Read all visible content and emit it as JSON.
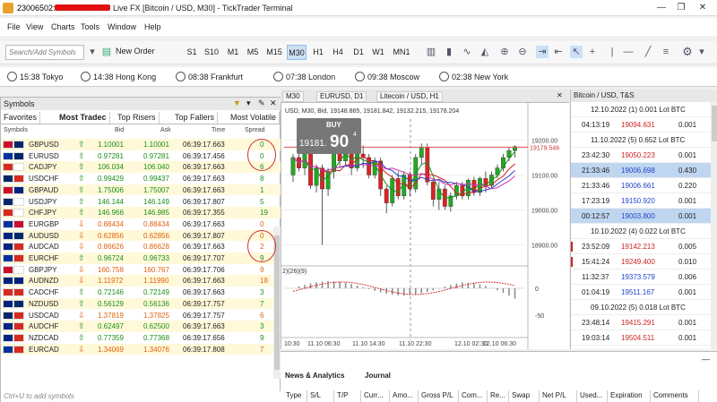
{
  "window": {
    "title_prefix": "23006502:",
    "title_suffix": "Live FX [Bitcoin / USD, M30] - TickTrader Terminal",
    "controls": [
      "—",
      "❐",
      "✕"
    ]
  },
  "menu": [
    "File",
    "View",
    "Charts",
    "Tools",
    "Window",
    "Help"
  ],
  "toolbar": {
    "search_placeholder": "Search/Add Symbols",
    "new_order": "New Order",
    "timeframes": [
      "S1",
      "S10",
      "M1",
      "M5",
      "M15",
      "M30",
      "H1",
      "H4",
      "D1",
      "W1",
      "MN1"
    ],
    "active_timeframe": "M30"
  },
  "clocks": [
    {
      "time": "15:38",
      "city": "Tokyo"
    },
    {
      "time": "14:38",
      "city": "Hong Kong"
    },
    {
      "time": "08:38",
      "city": "Frankfurt"
    },
    {
      "time": "07:38",
      "city": "London"
    },
    {
      "time": "09:38",
      "city": "Moscow"
    },
    {
      "time": "02:38",
      "city": "New York"
    }
  ],
  "symbols_panel": {
    "title": "Symbols",
    "tabs": [
      "Favorites",
      "Most Tradec",
      "Top Risers",
      "Top Fallers",
      "Most Volatile"
    ],
    "selected_tab": "Most Tradec",
    "columns": {
      "symbol": "Symbols",
      "bid": "Bid",
      "ask": "Ask",
      "time": "Time",
      "spread": "Spread"
    },
    "rows": [
      {
        "symbol": "GBPUSD",
        "dir": "up",
        "bid": "1.10001",
        "ask": "1.10001",
        "time": "06:39:17.663",
        "spread": "0",
        "flags": [
          "#c8102e",
          "#002868"
        ]
      },
      {
        "symbol": "EURUSD",
        "dir": "up",
        "bid": "0.97281",
        "ask": "0.97281",
        "time": "06:39:17.456",
        "spread": "0",
        "flags": [
          "#003399",
          "#002868"
        ]
      },
      {
        "symbol": "CADJPY",
        "dir": "up",
        "bid": "106.034",
        "ask": "106.040",
        "time": "06:39:17.663",
        "spread": "6",
        "flags": [
          "#d52b1e",
          "#ffffff"
        ]
      },
      {
        "symbol": "USDCHF",
        "dir": "up",
        "bid": "0.99429",
        "ask": "0.99437",
        "time": "06:39:17.663",
        "spread": "8",
        "flags": [
          "#002868",
          "#d52b1e"
        ]
      },
      {
        "symbol": "GBPAUD",
        "dir": "up",
        "bid": "1.75006",
        "ask": "1.75007",
        "time": "06:39:17.663",
        "spread": "1",
        "flags": [
          "#c8102e",
          "#00247d"
        ]
      },
      {
        "symbol": "USDJPY",
        "dir": "up",
        "bid": "146.144",
        "ask": "146.149",
        "time": "06:39:17.807",
        "spread": "5",
        "flags": [
          "#002868",
          "#ffffff"
        ]
      },
      {
        "symbol": "CHFJPY",
        "dir": "up",
        "bid": "146.966",
        "ask": "146.985",
        "time": "06:39:17.355",
        "spread": "19",
        "flags": [
          "#d52b1e",
          "#ffffff"
        ]
      },
      {
        "symbol": "EURGBP",
        "dir": "down",
        "bid": "0.88434",
        "ask": "0.88434",
        "time": "06:39:17.663",
        "spread": "0",
        "flags": [
          "#003399",
          "#c8102e"
        ]
      },
      {
        "symbol": "AUDUSD",
        "dir": "down",
        "bid": "0.62856",
        "ask": "0.62856",
        "time": "06:39:17.807",
        "spread": "0",
        "flags": [
          "#00247d",
          "#002868"
        ]
      },
      {
        "symbol": "AUDCAD",
        "dir": "down",
        "bid": "0.86626",
        "ask": "0.86628",
        "time": "06:39:17.663",
        "spread": "2",
        "flags": [
          "#00247d",
          "#d52b1e"
        ]
      },
      {
        "symbol": "EURCHF",
        "dir": "up",
        "bid": "0.96724",
        "ask": "0.96733",
        "time": "06:39:17.707",
        "spread": "9",
        "flags": [
          "#003399",
          "#d52b1e"
        ]
      },
      {
        "symbol": "GBPJPY",
        "dir": "down",
        "bid": "160.758",
        "ask": "160.767",
        "time": "06:39:17.706",
        "spread": "9",
        "flags": [
          "#c8102e",
          "#ffffff"
        ]
      },
      {
        "symbol": "AUDNZD",
        "dir": "down",
        "bid": "1.11972",
        "ask": "1.11990",
        "time": "06:39:17.663",
        "spread": "18",
        "flags": [
          "#00247d",
          "#00247d"
        ]
      },
      {
        "symbol": "CADCHF",
        "dir": "up",
        "bid": "0.72146",
        "ask": "0.72149",
        "time": "06:39:17.663",
        "spread": "3",
        "flags": [
          "#d52b1e",
          "#d52b1e"
        ]
      },
      {
        "symbol": "NZDUSD",
        "dir": "up",
        "bid": "0.56129",
        "ask": "0.56136",
        "time": "06:39:17.757",
        "spread": "7",
        "flags": [
          "#00247d",
          "#002868"
        ]
      },
      {
        "symbol": "USDCAD",
        "dir": "down",
        "bid": "1.37819",
        "ask": "1.37825",
        "time": "06:39:17.757",
        "spread": "6",
        "flags": [
          "#002868",
          "#d52b1e"
        ]
      },
      {
        "symbol": "AUDCHF",
        "dir": "up",
        "bid": "0.62497",
        "ask": "0.62500",
        "time": "06:39:17.663",
        "spread": "3",
        "flags": [
          "#00247d",
          "#d52b1e"
        ]
      },
      {
        "symbol": "NZDCAD",
        "dir": "up",
        "bid": "0.77359",
        "ask": "0.77368",
        "time": "06:39:17.656",
        "spread": "9",
        "flags": [
          "#00247d",
          "#d52b1e"
        ]
      },
      {
        "symbol": "EURCAD",
        "dir": "down",
        "bid": "1.34069",
        "ask": "1.34076",
        "time": "06:39:17.808",
        "spread": "7",
        "flags": [
          "#003399",
          "#d52b1e"
        ]
      }
    ],
    "footer_hint": "Ctrl+U to add symbols"
  },
  "chart": {
    "tabs": [
      "M30",
      "EURUSD, D1",
      "Litecoin / USD, H1"
    ],
    "info_line": "USD, M30, Bid, 19148.865, 19181.842, 19132.215, 19178.204",
    "buy_label": "BUY",
    "price_main": "19181.",
    "price_big": "90",
    "price_small": "4",
    "price_axis": [
      "19200.00",
      "19100.00",
      "19000.00",
      "18900.00"
    ],
    "current_price_label": "19179.546",
    "indicator_label": "2)(26)(9)",
    "indicator_axis": [
      "0",
      "-50"
    ],
    "time_axis": [
      "10:30",
      "11.10 06:30",
      "11.10 14:30",
      "11.10 22:30",
      "12.10 02:30",
      "12.10 06:30"
    ],
    "up_color": "#22aa22",
    "down_color": "#dd2222"
  },
  "time_sales": {
    "title": "Bitcoin / USD, T&S",
    "rows": [
      {
        "kind": "header",
        "text": "12.10.2022 (1) 0.001 Lot BTC"
      },
      {
        "kind": "trade",
        "time": "04:13:19",
        "price": "19094.631",
        "vol": "0.001",
        "color": "#cc2222",
        "mark": ""
      },
      {
        "kind": "header",
        "text": "11.10.2022 (5) 0.652 Lot BTC"
      },
      {
        "kind": "trade",
        "time": "23:42:30",
        "price": "19050.223",
        "vol": "0.001",
        "color": "#cc2222",
        "mark": ""
      },
      {
        "kind": "trade",
        "time": "21:33:46",
        "price": "19006.698",
        "vol": "0.430",
        "color": "#2244cc",
        "mark": "sel"
      },
      {
        "kind": "trade",
        "time": "21:33:46",
        "price": "19006.661",
        "vol": "0.220",
        "color": "#2244cc",
        "mark": ""
      },
      {
        "kind": "trade",
        "time": "17:23:19",
        "price": "19150.920",
        "vol": "0.001",
        "color": "#2244cc",
        "mark": ""
      },
      {
        "kind": "trade",
        "time": "00:12:57",
        "price": "19003.800",
        "vol": "0.001",
        "color": "#2244cc",
        "mark": "sel"
      },
      {
        "kind": "header",
        "text": "10.10.2022 (4) 0.022 Lot BTC"
      },
      {
        "kind": "trade",
        "time": "23:52:09",
        "price": "19142.213",
        "vol": "0.005",
        "color": "#cc2222",
        "mark": "red"
      },
      {
        "kind": "trade",
        "time": "15:41:24",
        "price": "19249.400",
        "vol": "0.010",
        "color": "#cc2222",
        "mark": "red"
      },
      {
        "kind": "trade",
        "time": "11:32:37",
        "price": "19373.579",
        "vol": "0.006",
        "color": "#2244cc",
        "mark": ""
      },
      {
        "kind": "trade",
        "time": "01:04:19",
        "price": "19511.167",
        "vol": "0.001",
        "color": "#2244cc",
        "mark": ""
      },
      {
        "kind": "header",
        "text": "09.10.2022 (5) 0.018 Lot BTC"
      },
      {
        "kind": "trade",
        "time": "23:48:14",
        "price": "19415.291",
        "vol": "0.001",
        "color": "#cc2222",
        "mark": ""
      },
      {
        "kind": "trade",
        "time": "19:03:14",
        "price": "19504.511",
        "vol": "0.001",
        "color": "#cc2222",
        "mark": ""
      }
    ]
  },
  "bottom_panel": {
    "tabs": [
      "News & Analytics",
      "Journal"
    ],
    "columns": [
      "Type",
      "S/L",
      "T/P",
      "Curr...",
      "Amo...",
      "Gross P/L",
      "Com...",
      "Re...",
      "Swap",
      "Net P/L",
      "Used...",
      "Expiration",
      "Comments"
    ]
  },
  "chart_data": {
    "type": "candlestick",
    "symbol": "Bitcoin / USD",
    "timeframe": "M30",
    "x_labels": [
      "10:30",
      "11.10 06:30",
      "11.10 14:30",
      "11.10 22:30",
      "12.10 02:30",
      "12.10 06:30"
    ],
    "ylim": [
      18850,
      19260
    ],
    "current_price": 19179.546,
    "candles": [
      [
        19100,
        19150,
        19080,
        19160
      ],
      [
        19150,
        19120,
        19110,
        19180
      ],
      [
        19120,
        19160,
        19100,
        19170
      ],
      [
        19160,
        19070,
        19060,
        19170
      ],
      [
        19070,
        19120,
        19050,
        19130
      ],
      [
        19120,
        19060,
        18900,
        19130
      ],
      [
        19060,
        19110,
        19040,
        19120
      ],
      [
        19110,
        19170,
        19090,
        19180
      ],
      [
        19170,
        19140,
        19120,
        19185
      ],
      [
        19140,
        19175,
        19130,
        19190
      ],
      [
        19175,
        19120,
        19100,
        19180
      ],
      [
        19120,
        19160,
        19110,
        19170
      ],
      [
        19160,
        19150,
        19120,
        19185
      ],
      [
        19150,
        19100,
        19090,
        19160
      ],
      [
        19100,
        19140,
        19090,
        19150
      ],
      [
        19140,
        19060,
        19040,
        19150
      ],
      [
        19060,
        19020,
        18990,
        19070
      ],
      [
        19020,
        19090,
        19010,
        19100
      ],
      [
        19090,
        19040,
        19030,
        19110
      ],
      [
        19040,
        19100,
        19030,
        19110
      ],
      [
        19100,
        19060,
        19040,
        19110
      ],
      [
        19060,
        19150,
        19050,
        19160
      ],
      [
        19150,
        19180,
        19130,
        19190
      ],
      [
        19180,
        19080,
        19070,
        19190
      ],
      [
        19080,
        19030,
        19010,
        19090
      ],
      [
        19030,
        19060,
        19000,
        19080
      ],
      [
        19060,
        19010,
        19000,
        19070
      ],
      [
        19010,
        19040,
        18995,
        19050
      ],
      [
        19040,
        19070,
        19030,
        19080
      ],
      [
        19070,
        19040,
        19030,
        19080
      ],
      [
        19040,
        19085,
        19030,
        19090
      ],
      [
        19085,
        19050,
        19040,
        19095
      ],
      [
        19050,
        19090,
        19040,
        19095
      ],
      [
        19090,
        19070,
        19050,
        19110
      ],
      [
        19070,
        19100,
        19060,
        19110
      ],
      [
        19100,
        19120,
        19090,
        19130
      ],
      [
        19120,
        19150,
        19110,
        19160
      ],
      [
        19150,
        19170,
        19140,
        19180
      ],
      [
        19170,
        19181,
        19150,
        19185
      ]
    ]
  }
}
